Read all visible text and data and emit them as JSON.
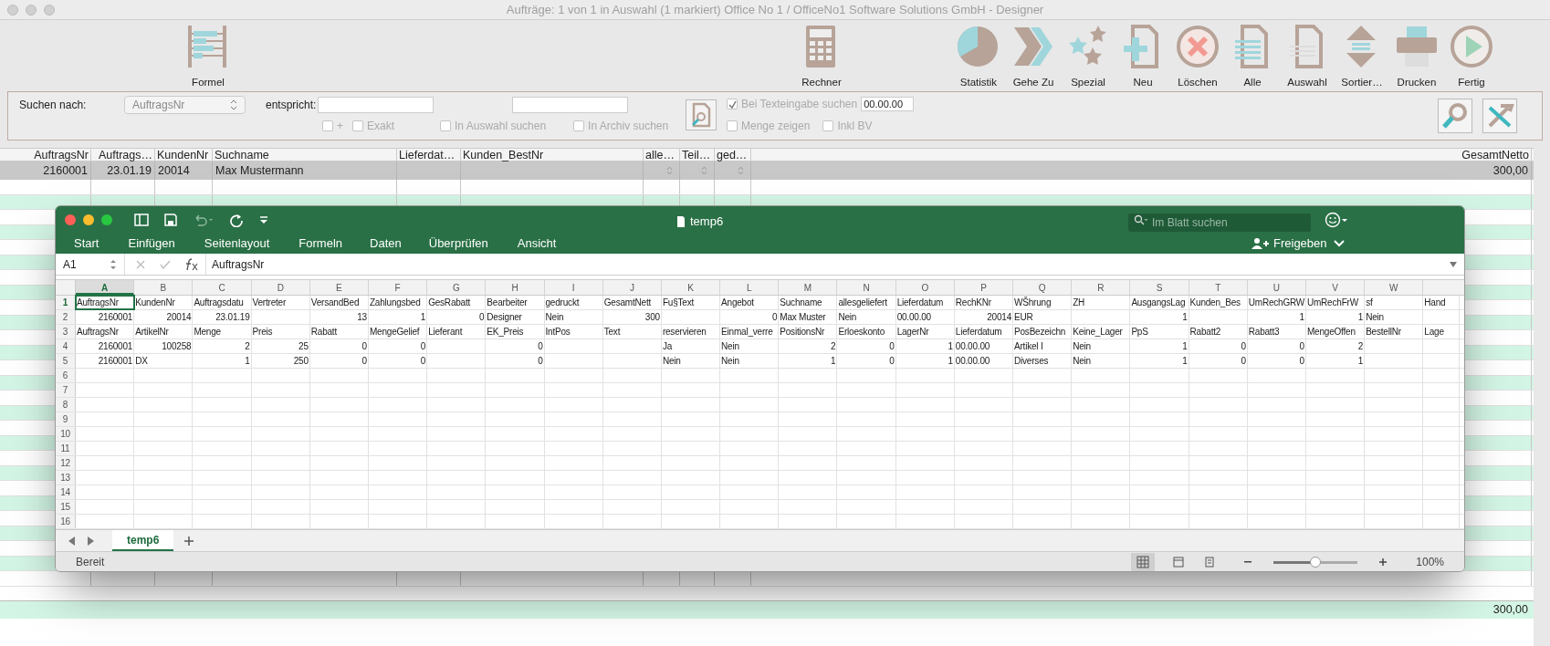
{
  "window": {
    "title": "Aufträge: 1 von 1 in Auswahl  (1 markiert) Office No 1 /  OfficeNo1 Software Solutions GmbH - Designer"
  },
  "toolbar": {
    "buttons": [
      {
        "label": "Formel",
        "kind": "abacus"
      },
      {
        "label": "Rechner",
        "kind": "calculator"
      },
      {
        "label": "Statistik",
        "kind": "pie"
      },
      {
        "label": "Gehe Zu",
        "kind": "chevron"
      },
      {
        "label": "Spezial",
        "kind": "stars"
      },
      {
        "label": "Neu",
        "kind": "new"
      },
      {
        "label": "Löschen",
        "kind": "delete"
      },
      {
        "label": "Alle",
        "kind": "all"
      },
      {
        "label": "Auswahl",
        "kind": "selection"
      },
      {
        "label": "Sortier…",
        "kind": "sort"
      },
      {
        "label": "Drucken",
        "kind": "print"
      },
      {
        "label": "Fertig",
        "kind": "play"
      }
    ]
  },
  "search": {
    "label": "Suchen nach:",
    "field": "AuftragsNr",
    "match_label": "entspricht:",
    "date_value": "00.00.00",
    "options": [
      {
        "label": "+",
        "checked": false
      },
      {
        "label": "Exakt",
        "checked": false
      },
      {
        "label": "In Auswahl suchen",
        "checked": false
      },
      {
        "label": "In Archiv suchen",
        "checked": false
      },
      {
        "label": "Bei Texteingabe suchen",
        "checked": true
      },
      {
        "label": "Menge zeigen",
        "checked": false
      },
      {
        "label": "Inkl BV",
        "checked": false
      }
    ]
  },
  "table": {
    "columns": [
      "AuftragsNr",
      "Auftrags…",
      "KundenNr",
      "Suchname",
      "Lieferdat…",
      "Kunden_BestNr",
      "alle…",
      "Teil…",
      "ged…",
      "GesamtNetto"
    ],
    "rows": [
      {
        "cells": [
          "2160001",
          "23.01.19",
          "20014",
          "Max Mustermann",
          "",
          "",
          "",
          "",
          "",
          "300,00"
        ],
        "selected": true
      }
    ],
    "total": "300,00"
  },
  "excel": {
    "title": "temp6",
    "search_placeholder": "Im Blatt suchen",
    "tabs": [
      "Start",
      "Einfügen",
      "Seitenlayout",
      "Formeln",
      "Daten",
      "Überprüfen",
      "Ansicht"
    ],
    "share": "Freigeben",
    "name_box": "A1",
    "formula": "AuftragsNr",
    "columns": [
      "A",
      "B",
      "C",
      "D",
      "E",
      "F",
      "G",
      "H",
      "I",
      "J",
      "K",
      "L",
      "M",
      "N",
      "O",
      "P",
      "Q",
      "R",
      "S",
      "T",
      "U",
      "V",
      "W"
    ],
    "row_numbers": [
      "1",
      "2",
      "3",
      "4",
      "5",
      "6",
      "7",
      "8",
      "9",
      "10",
      "11",
      "12",
      "13",
      "14",
      "15",
      "16"
    ],
    "rows": [
      [
        "AuftragsNr",
        "KundenNr",
        "Auftragsdatu",
        "Vertreter",
        "VersandBed",
        "Zahlungsbed",
        "GesRabatt",
        "Bearbeiter",
        "gedruckt",
        "GesamtNett",
        "Fu§Text",
        "Angebot",
        "Suchname",
        "allesgeliefert",
        "Lieferdatum",
        "RechKNr",
        "WŠhrung",
        "ZH",
        "AusgangsLag",
        "Kunden_Bes",
        "UmRechGRW",
        "UmRechFrW",
        "sf",
        "Hand"
      ],
      [
        "2160001",
        "20014",
        "23.01.19",
        "",
        "13",
        "1",
        "0",
        "Designer",
        "Nein",
        "300",
        "",
        "0",
        "Max Muster",
        "Nein",
        "00.00.00",
        "20014",
        "EUR",
        "",
        "1",
        "",
        "1",
        "1",
        "Nein",
        ""
      ],
      [
        "AuftragsNr",
        "ArtikelNr",
        "Menge",
        "Preis",
        "Rabatt",
        "MengeGelief",
        "Lieferant",
        "EK_Preis",
        "IntPos",
        "Text",
        "reservieren",
        "Einmal_verre",
        "PositionsNr",
        "Erloeskonto",
        "LagerNr",
        "Lieferdatum",
        "PosBezeichn",
        "Keine_Lager",
        "PpS",
        "Rabatt2",
        "Rabatt3",
        "MengeOffen",
        "BestellNr",
        "Lage"
      ],
      [
        "2160001",
        "100258",
        "2",
        "25",
        "0",
        "0",
        "",
        "0",
        "",
        "",
        "Ja",
        "Nein",
        "2",
        "0",
        "1",
        "00.00.00",
        "Artikel I",
        "Nein",
        "1",
        "0",
        "0",
        "2",
        "",
        ""
      ],
      [
        "2160001",
        "DX",
        "1",
        "250",
        "0",
        "0",
        "",
        "0",
        "",
        "",
        "Nein",
        "Nein",
        "1",
        "0",
        "1",
        "00.00.00",
        "Diverses",
        "Nein",
        "1",
        "0",
        "0",
        "1",
        "",
        ""
      ]
    ],
    "sheet_tab": "temp6",
    "status": "Bereit",
    "zoom": "100%",
    "zoom_slider": {
      "level": 0.5
    }
  }
}
